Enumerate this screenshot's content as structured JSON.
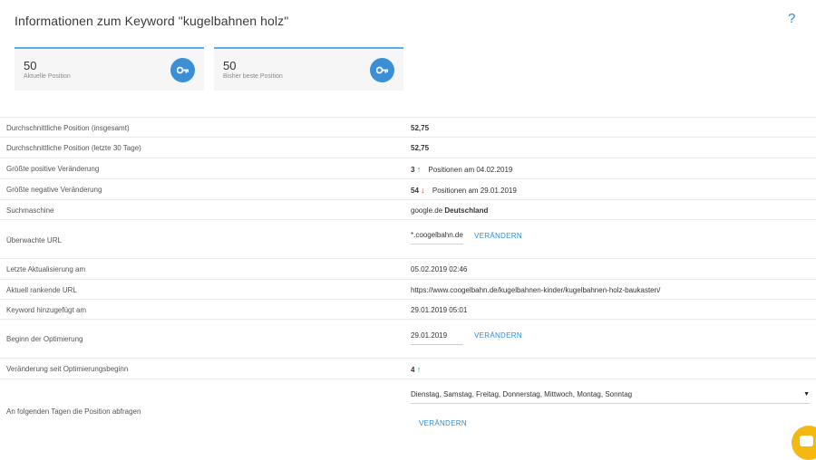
{
  "title": "Informationen zum Keyword \"kugelbahnen holz\"",
  "help_label": "?",
  "cards": [
    {
      "value": "50",
      "label": "Aktuelle Position",
      "icon": "key-icon"
    },
    {
      "value": "50",
      "label": "Bisher beste Position",
      "icon": "key-icon"
    }
  ],
  "rows": {
    "avg_total": {
      "label": "Durchschnittliche Position (insgesamt)",
      "value": "52,75"
    },
    "avg_30": {
      "label": "Durchschnittliche Position (letzte 30 Tage)",
      "value": "52,75"
    },
    "pos_change": {
      "label": "Größte positive Veränderung",
      "value": "3",
      "arrow": "↑",
      "text": "Positionen am 04.02.2019"
    },
    "neg_change": {
      "label": "Größte negative Veränderung",
      "value": "54",
      "arrow": "↓",
      "text": "Positionen am 29.01.2019"
    },
    "engine": {
      "label": "Suchmaschine",
      "value": "google.de",
      "country": "Deutschland"
    },
    "url": {
      "label": "Überwachte URL",
      "value": "*.coogelbahn.de",
      "action": "VERÄNDERN"
    },
    "last_update": {
      "label": "Letzte Aktualisierung am",
      "value": "05.02.2019 02:46"
    },
    "ranking_url": {
      "label": "Aktuell rankende URL",
      "value": "https://www.coogelbahn.de/kugelbahnen-kinder/kugelbahnen-holz-baukasten/"
    },
    "added": {
      "label": "Keyword hinzugefügt am",
      "value": "29.01.2019 05:01"
    },
    "opt_start": {
      "label": "Beginn der Optimierung",
      "value": "29.01.2019",
      "action": "VERÄNDERN"
    },
    "change_since": {
      "label": "Veränderung seit Optimierungsbeginn",
      "value": "4",
      "arrow": "↑"
    },
    "days": {
      "label": "An folgenden Tagen die Position abfragen",
      "value": "Dienstag, Samstag, Freitag, Donnerstag, Mittwoch, Montag, Sonntag",
      "action": "VERÄNDERN",
      "arrow": "▼"
    }
  },
  "colors": {
    "accent": "#2f8dd6",
    "up": "#2e9e5b",
    "down": "#d9442f",
    "chat": "#f5b812"
  }
}
